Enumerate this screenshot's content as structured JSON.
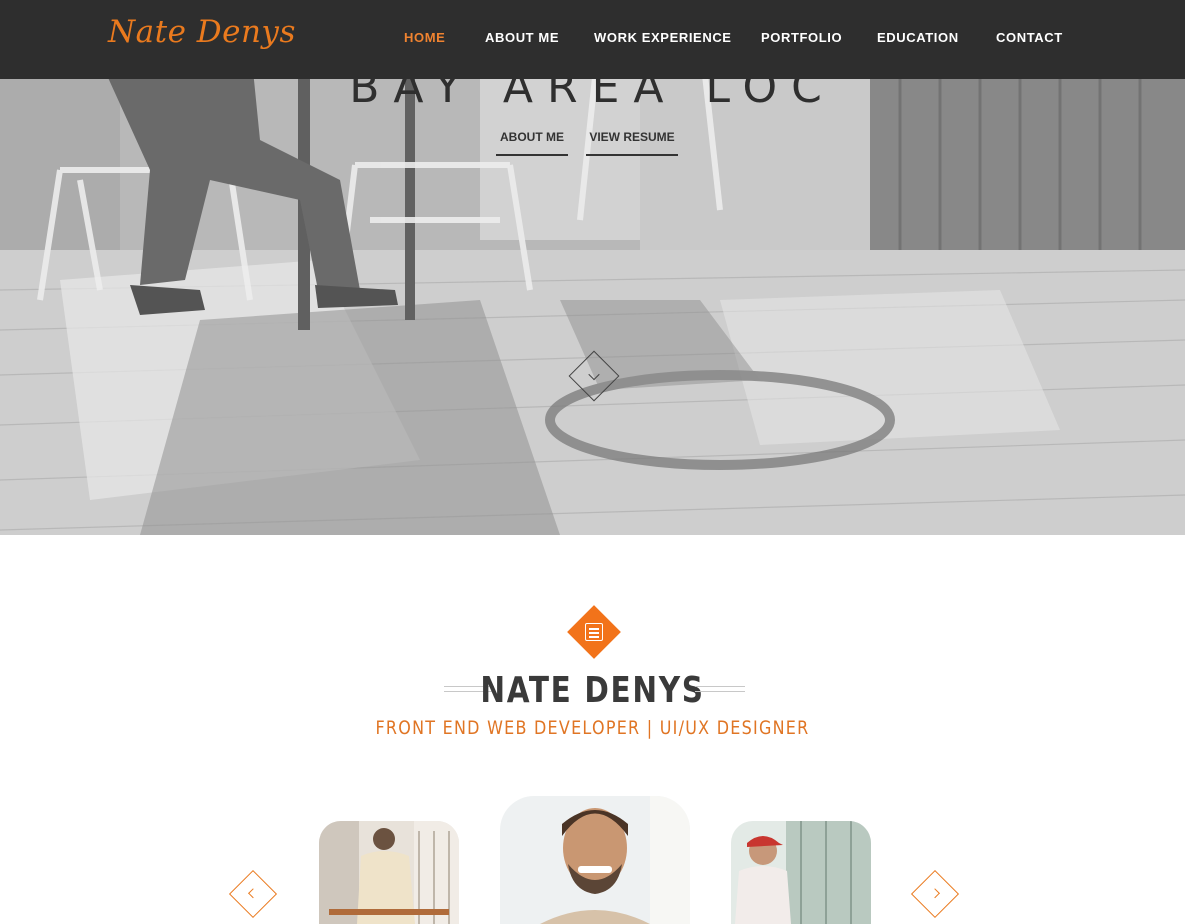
{
  "brand": {
    "logo_text": "Nate Denys",
    "accent_color": "#ea7a1e"
  },
  "nav": {
    "items": [
      {
        "label": "HOME",
        "active": true
      },
      {
        "label": "ABOUT ME",
        "active": false
      },
      {
        "label": "WORK EXPERIENCE",
        "active": false
      },
      {
        "label": "PORTFOLIO",
        "active": false
      },
      {
        "label": "EDUCATION",
        "active": false
      },
      {
        "label": "CONTACT",
        "active": false
      }
    ]
  },
  "hero": {
    "heading": "BAY AREA LOC",
    "buttons": {
      "about_label": "ABOUT ME",
      "resume_label": "VIEW RESUME"
    },
    "scroll_icon": "chevron-down-icon"
  },
  "about": {
    "badge_icon": "id-card-icon",
    "name": "NATE DENYS",
    "subtitle": "FRONT END WEB DEVELOPER | UI/UX DESIGNER",
    "carousel": {
      "prev_icon": "chevron-left-icon",
      "next_icon": "chevron-right-icon",
      "photos": [
        "photo-at-desk",
        "portrait-smiling",
        "photo-with-cap"
      ]
    }
  }
}
